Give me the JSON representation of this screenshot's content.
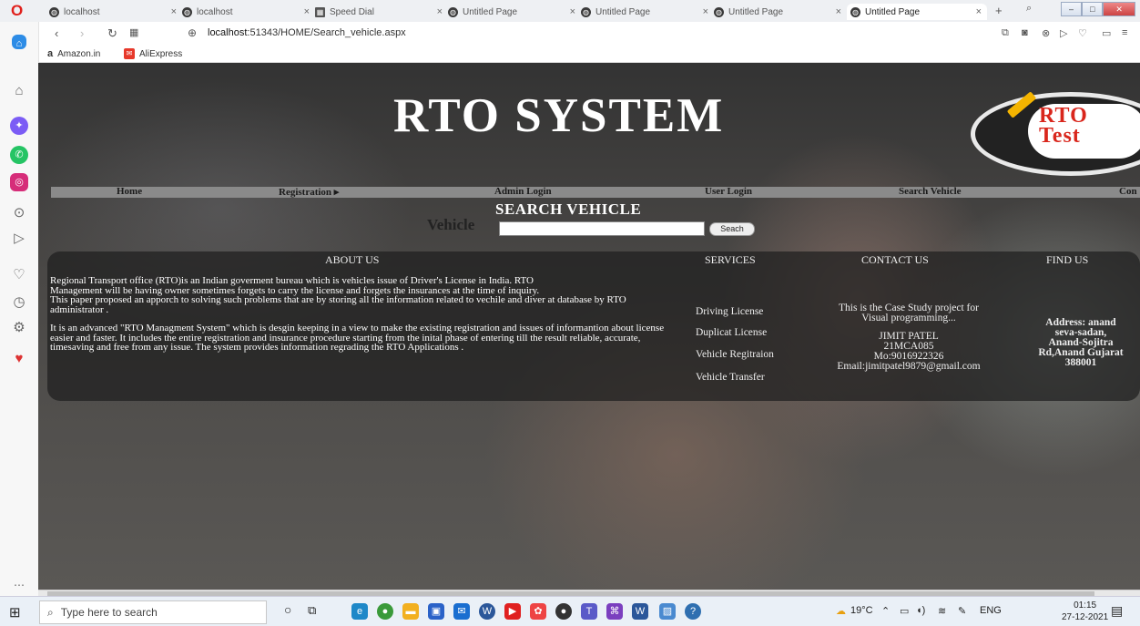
{
  "browser": {
    "tabs": [
      {
        "label": "localhost"
      },
      {
        "label": "localhost"
      },
      {
        "label": "Speed Dial"
      },
      {
        "label": "Untitled Page"
      },
      {
        "label": "Untitled Page"
      },
      {
        "label": "Untitled Page"
      },
      {
        "label": "Untitled Page"
      }
    ],
    "url_host": "localhost",
    "url_path": ":51343/HOME/Search_vehicle.aspx",
    "bookmarks": [
      "Amazon.in",
      "AliExpress"
    ]
  },
  "page": {
    "title": "RTO SYSTEM",
    "logo_text_1": "RTO",
    "logo_text_2": "Test",
    "menu": [
      "Home",
      "Registration ▸",
      "Admin Login",
      "User Login",
      "Search Vehicle",
      "Con"
    ],
    "search_title": "SEARCH VEHICLE",
    "vehicle_label": "Vehicle",
    "vehicle_value": "",
    "search_button": "Seach",
    "footer": {
      "about_heading": "ABOUT US",
      "services_heading": "SERVICES",
      "contact_heading": "CONTACT US",
      "find_heading": "FIND US",
      "about_p1": "Regional Transport office (RTO)is an Indian goverment bureau which is vehicles issue of Driver's License in India. RTO",
      "about_p2": "Management will be having owner sometimes forgets to carry the license and forgets the insurances at the time of inquiry.",
      "about_p3": "This paper proposed an apporch to solving such problems that are by storing all the information related to vechile and diver at database by RTO administrator .",
      "about_p4": "It is an advanced \"RTO Managment System\" which is desgin keeping in a view to make the existing registration and issues of informantion about license easier and faster. It includes the entire registration and insurance procedure starting from the inital phase of entering till the result reliable, accurate, timesaving and free from any issue. The system provides information regrading the RTO Applications .",
      "services": [
        "Driving License",
        "Duplicat License",
        "Vehicle Regitraion",
        "Vehicle Transfer"
      ],
      "contact_line1": "This is the Case Study project for",
      "contact_line2": "Visual programming...",
      "contact_name": "JIMIT PATEL",
      "contact_id": "21MCA085",
      "contact_mobile": "Mo:9016922326",
      "contact_email": "Email:jimitpatel9879@gmail.com",
      "find_l1": "Address: anand",
      "find_l2": "seva-sadan,",
      "find_l3": "Anand-Sojitra",
      "find_l4": "Rd,Anand Gujarat",
      "find_l5": "388001"
    }
  },
  "taskbar": {
    "search_placeholder": "Type here to search",
    "temperature": "19°C",
    "language": "ENG",
    "time": "01:15",
    "date": "27-12-2021"
  }
}
